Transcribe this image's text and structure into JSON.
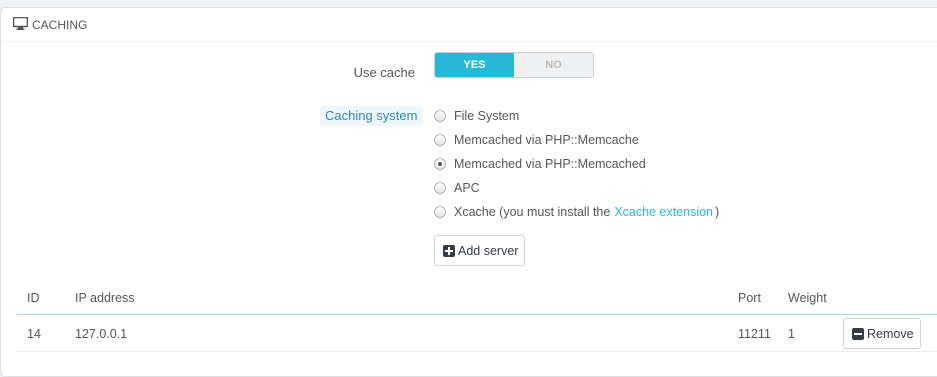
{
  "panel": {
    "title": "CACHING",
    "icon": "desktop-icon"
  },
  "use_cache": {
    "label": "Use cache",
    "yes": "YES",
    "no": "NO",
    "selected": "YES",
    "accent": "#25b9d7"
  },
  "caching_system": {
    "label": "Caching system",
    "options": [
      {
        "label": "File System",
        "checked": false
      },
      {
        "label": "Memcached via PHP::Memcache",
        "checked": false
      },
      {
        "label": "Memcached via PHP::Memcached",
        "checked": true
      },
      {
        "label": "APC",
        "checked": false
      },
      {
        "label": "Xcache (you must install the",
        "link": "Xcache extension",
        "suffix": ")",
        "checked": false
      }
    ]
  },
  "add_server": {
    "label": "Add server",
    "icon": "plus-square-icon"
  },
  "table": {
    "headers": {
      "id": "ID",
      "ip": "IP address",
      "port": "Port",
      "weight": "Weight"
    },
    "rows": [
      {
        "id": "14",
        "ip": "127.0.0.1",
        "port": "11211",
        "weight": "1",
        "action": "Remove",
        "action_icon": "minus-square-icon"
      }
    ]
  }
}
